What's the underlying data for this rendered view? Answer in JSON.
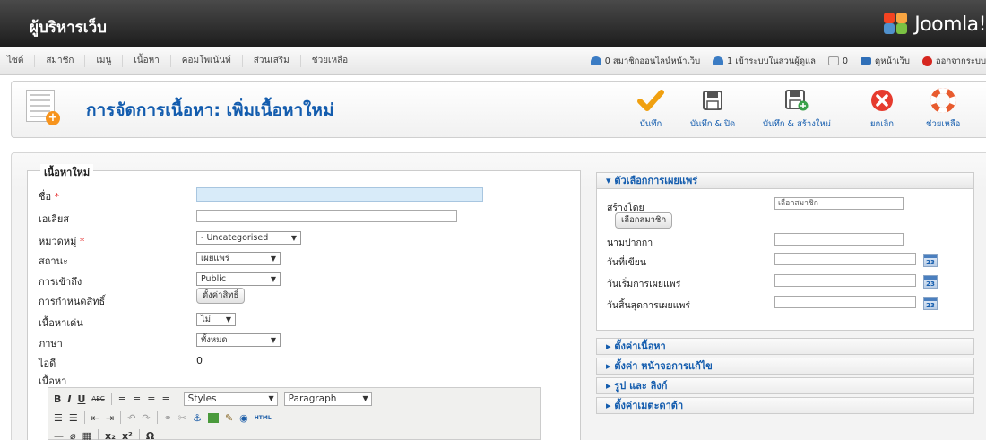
{
  "header": {
    "title": "ผู้บริหารเว็บ",
    "brand": "Joomla!"
  },
  "menu": [
    "ไซต์",
    "สมาชิก",
    "เมนู",
    "เนื้อหา",
    "คอมโพเน้นท์",
    "ส่วนเสริม",
    "ช่วยเหลือ"
  ],
  "status": {
    "online_members": "0 สมาชิกออนไลน์หน้าเว็บ",
    "admins": "1 เข้าระบบในส่วนผู้ดูแล",
    "messages": "0",
    "view_site": "ดูหน้าเว็บ",
    "logout": "ออกจากระบบ"
  },
  "toolbar": {
    "title": "การจัดการเนื้อหา: เพิ่มเนื้อหาใหม่",
    "save": "บันทึก",
    "save_close": "บันทึก & ปิด",
    "save_new": "บันทึก & สร้างใหม่",
    "cancel": "ยกเลิก",
    "help": "ช่วยเหลือ"
  },
  "form": {
    "legend": "เนื้อหาใหม่",
    "title_label": "ชื่อ",
    "title_value": "",
    "alias_label": "เอเลียส",
    "alias_value": "",
    "category_label": "หมวดหมู่",
    "category_value": "- Uncategorised",
    "state_label": "สถานะ",
    "state_value": "เผยแพร่",
    "access_label": "การเข้าถึง",
    "access_value": "Public",
    "permissions_label": "การกำหนดสิทธิ์",
    "permissions_button": "ตั้งค่าสิทธิ์",
    "featured_label": "เนื้อหาเด่น",
    "featured_value": "ไม่",
    "language_label": "ภาษา",
    "language_value": "ทั้งหมด",
    "id_label": "ไอดี",
    "id_value": "0",
    "content_label": "เนื้อหา",
    "required_mark": "*"
  },
  "editor": {
    "styles": "Styles",
    "paragraph": "Paragraph",
    "bold": "B",
    "italic": "I",
    "underline": "U",
    "strike": "ABC",
    "html": "HTML",
    "sub": "x₂",
    "sup": "x²",
    "omega": "Ω"
  },
  "publishing": {
    "heading": "ตัวเลือกการเผยแพร่",
    "created_by_label": "สร้างโดย",
    "created_by_value": "เลือกสมาชิก",
    "select_user_button": "เลือกสมาชิก",
    "alias_label": "นามปากกา",
    "created_date_label": "วันที่เขียน",
    "publish_up_label": "วันเริ่มการเผยแพร่",
    "publish_down_label": "วันสิ้นสุดการเผยแพร่",
    "calendar_day": "23"
  },
  "sections": [
    "ตั้งค่าเนื้อหา",
    "ตั้งค่า หน้าจอการแก้ไข",
    "รูป และ ลิงก์",
    "ตั้งค่าเมตะดาต้า"
  ]
}
